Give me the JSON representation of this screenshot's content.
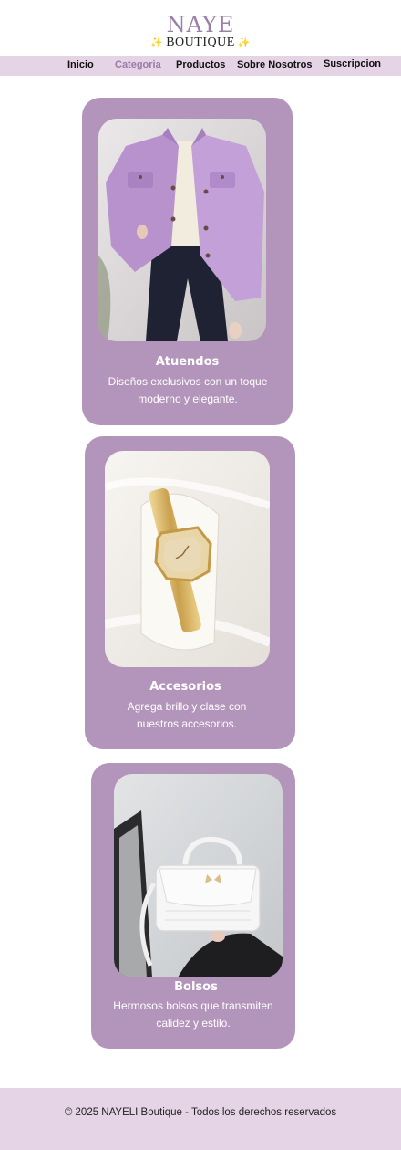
{
  "brand": {
    "name_top": "NAYE",
    "name_bottom": "BOUTIQUE"
  },
  "nav": [
    {
      "label": "Inicio",
      "active": false
    },
    {
      "label": "Categoria",
      "active": true
    },
    {
      "label": "Productos",
      "active": false
    },
    {
      "label": "Sobre Nosotros",
      "active": false
    },
    {
      "label": "Suscripcion",
      "active": false
    }
  ],
  "categories": [
    {
      "title": "Atuendos",
      "description": "Diseños exclusivos con un toque moderno y elegante.",
      "image": "purple-jacket-photo"
    },
    {
      "title": "Accesorios",
      "description": "Agrega brillo y clase con nuestros accesorios.",
      "image": "gold-watch-photo"
    },
    {
      "title": "Bolsos",
      "description": "Hermosos bolsos que transmiten calidez y estilo.",
      "image": "white-handbag-photo"
    }
  ],
  "footer": {
    "text": "© 2025 NAYELI Boutique - Todos los derechos reservados"
  },
  "colors": {
    "nav_bg": "#e5d3e6",
    "card_bg": "#b395bb",
    "brand": "#9a7fa8",
    "active_nav": "#9a7ba6"
  }
}
